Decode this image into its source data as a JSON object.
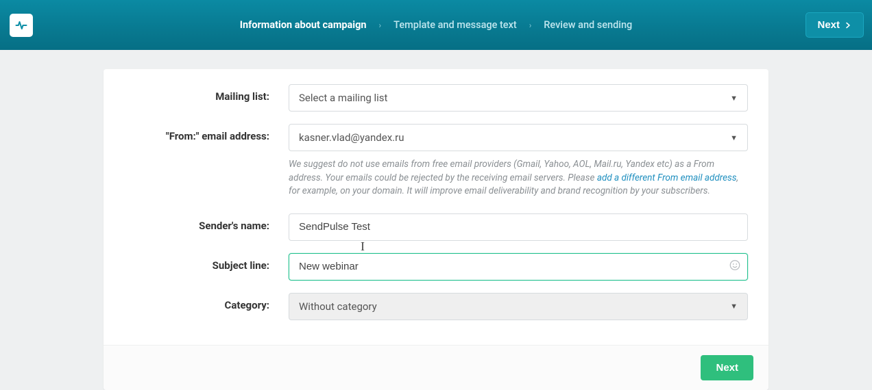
{
  "header": {
    "steps": [
      {
        "label": "Information about campaign",
        "active": true
      },
      {
        "label": "Template and message text",
        "active": false
      },
      {
        "label": "Review and sending",
        "active": false
      }
    ],
    "next_label": "Next"
  },
  "form": {
    "mailing_list": {
      "label": "Mailing list:",
      "placeholder": "Select a mailing list"
    },
    "from_email": {
      "label": "\"From:\" email address:",
      "value": "kasner.vlad@yandex.ru",
      "hint_before": "We suggest do not use emails from free email providers (Gmail, Yahoo, AOL, Mail.ru, Yandex etc) as a From address. Your emails could be rejected by the receiving email servers. Please ",
      "hint_link": "add a different From email address",
      "hint_after": ", for example, on your domain. It will improve email deliverability and brand recognition by your subscribers."
    },
    "sender_name": {
      "label": "Sender's name:",
      "value": "SendPulse Test"
    },
    "subject": {
      "label": "Subject line:",
      "value": "New webinar"
    },
    "category": {
      "label": "Category:",
      "value": "Without category"
    }
  },
  "footer": {
    "next_label": "Next"
  }
}
